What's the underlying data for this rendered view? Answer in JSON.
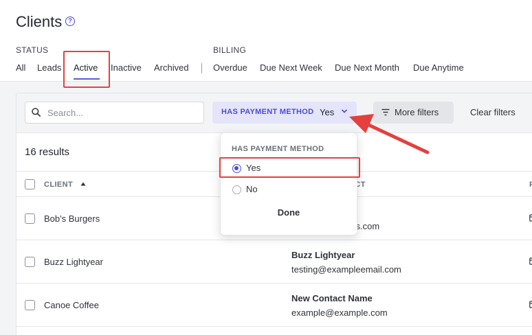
{
  "header": {
    "title": "Clients",
    "help_icon": "question-circle-icon",
    "status_label": "STATUS",
    "billing_label": "BILLING",
    "status_tabs": [
      "All",
      "Leads",
      "Active",
      "Inactive",
      "Archived"
    ],
    "billing_tabs": [
      "Overdue",
      "Due Next Week",
      "Due Next Month",
      "Due Anytime"
    ],
    "active_tab": "Active"
  },
  "filters": {
    "search_placeholder": "Search...",
    "payment_filter_label": "HAS PAYMENT METHOD",
    "payment_filter_value": "Yes",
    "more_filters_label": "More filters",
    "clear_filters_label": "Clear filters"
  },
  "results_text": "16 results",
  "table": {
    "columns": [
      "CLIENT",
      "ACT"
    ],
    "last_column_fragment": "F",
    "rows": [
      {
        "client": "Bob's Burgers",
        "contact_name": "",
        "contact_email": "ers.com"
      },
      {
        "client": "Buzz Lightyear",
        "contact_name": "Buzz Lightyear",
        "contact_email": "testing@exampleemail.com"
      },
      {
        "client": "Canoe Coffee",
        "contact_name": "New Contact Name",
        "contact_email": "example@example.com"
      }
    ]
  },
  "dropdown": {
    "title": "HAS PAYMENT METHOD",
    "options": [
      "Yes",
      "No"
    ],
    "selected": "Yes",
    "done_label": "Done"
  },
  "colors": {
    "accent": "#4b4bd6",
    "highlight": "#e5403e",
    "filter_pill_bg": "#e4e4fb",
    "content_bg": "#f3f4f6"
  }
}
